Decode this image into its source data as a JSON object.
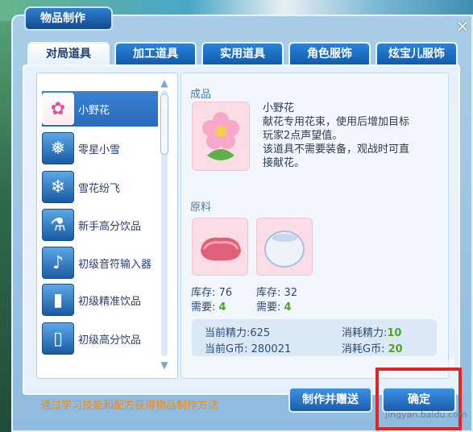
{
  "window": {
    "title": "物品制作",
    "close_label": "×"
  },
  "tabs": [
    {
      "label": "对局道具",
      "active": true
    },
    {
      "label": "加工道具",
      "active": false
    },
    {
      "label": "实用道具",
      "active": false
    },
    {
      "label": "角色服饰",
      "active": false
    },
    {
      "label": "炫宝儿服饰",
      "active": false
    }
  ],
  "items": [
    {
      "label": "小野花",
      "icon": "flower-icon",
      "glyph": "✿",
      "selected": true
    },
    {
      "label": "零星小雪",
      "icon": "snow-icon",
      "glyph": "❅",
      "selected": false
    },
    {
      "label": "雪花纷飞",
      "icon": "snowflake-icon",
      "glyph": "❄",
      "selected": false
    },
    {
      "label": "新手高分饮品",
      "icon": "potion-icon",
      "glyph": "⚗",
      "selected": false
    },
    {
      "label": "初级音符输入器",
      "icon": "joystick-icon",
      "glyph": "♪",
      "selected": false
    },
    {
      "label": "初级精准饮品",
      "icon": "drink-can-icon",
      "glyph": "▮",
      "selected": false
    },
    {
      "label": "初级高分饮品",
      "icon": "drink-can-icon",
      "glyph": "▯",
      "selected": false
    }
  ],
  "detail": {
    "product_header": "成品",
    "product_name": "小野花",
    "description_lines": [
      "献花专用花束，使用后增加目标",
      "玩家2点声望值。",
      "该道具不需要装备，观战时可直",
      "接献花。"
    ],
    "materials_header": "原料",
    "materials": [
      {
        "icon": "meat-icon",
        "stock_label": "库存:",
        "stock": "76",
        "need_label": "需要:",
        "need": "4"
      },
      {
        "icon": "crystal-ball-icon",
        "stock_label": "库存:",
        "stock": "32",
        "need_label": "需要:",
        "need": "4"
      }
    ],
    "energy": {
      "current_energy_label": "当前精力:",
      "current_energy": "625",
      "current_gold_label": "当前G币:",
      "current_gold": "280021",
      "cost_energy_label": "消耗精力:",
      "cost_energy": "10",
      "cost_gold_label": "消耗G币:",
      "cost_gold": "20"
    }
  },
  "footer": {
    "tip": "通过学习技能和配方获得物品制作方法",
    "gift_button": "制作并赠送",
    "confirm_button": "确定"
  },
  "watermark": "jingyan.baidu.com",
  "colors": {
    "accent": "#1b5cab",
    "tip": "#ef8a18",
    "highlight": "#e22424",
    "need": "#53a321"
  }
}
